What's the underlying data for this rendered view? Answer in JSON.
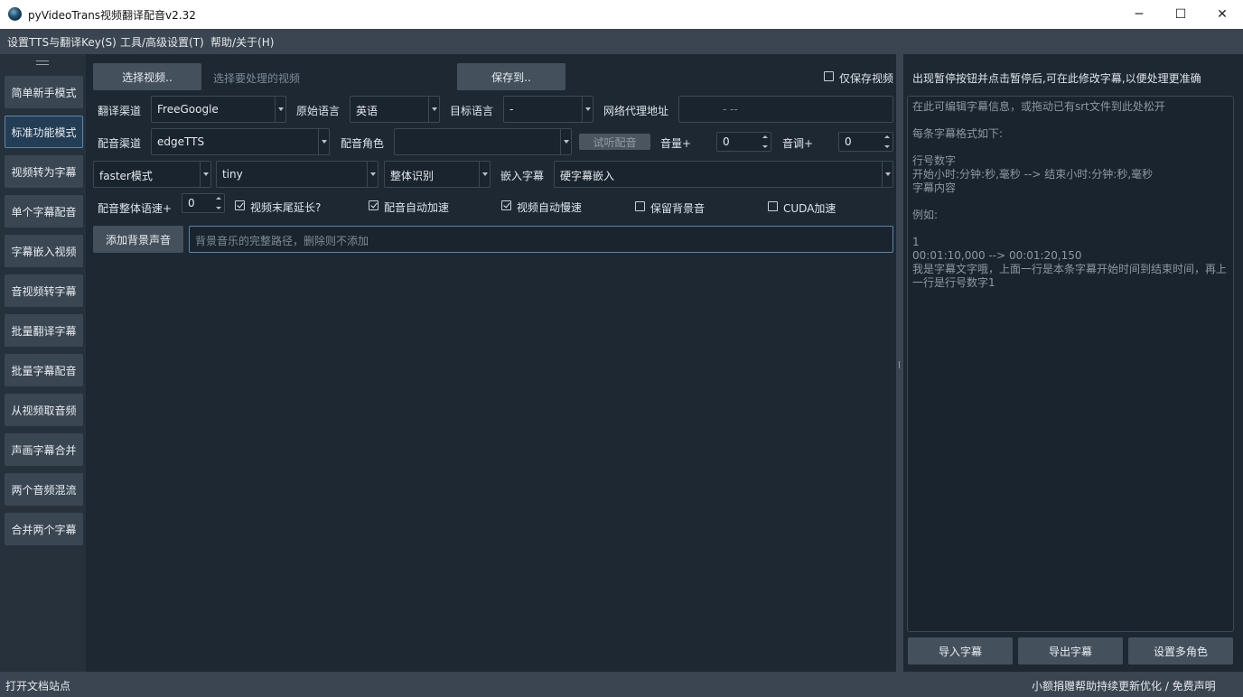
{
  "window": {
    "title": "pyVideoTrans视频翻译配音v2.32",
    "minimize_glyph": "─",
    "maximize_glyph": "☐",
    "close_glyph": "✕"
  },
  "menu": {
    "items": [
      "设置TTS与翻译Key(S)",
      "工具/高级设置(T)",
      "帮助/关于(H)"
    ]
  },
  "sidebar": {
    "items": [
      "简单新手模式",
      "标准功能模式",
      "视频转为字幕",
      "单个字幕配音",
      "字幕嵌入视频",
      "音视频转字幕",
      "批量翻译字幕",
      "批量字幕配音",
      "从视频取音频",
      "声画字幕合并",
      "两个音频混流",
      "合并两个字幕"
    ],
    "active_index": 1
  },
  "main": {
    "select_video_button": "选择视频..",
    "select_video_hint": "选择要处理的视频",
    "save_to_button": "保存到..",
    "only_save_video": "仅保存视频",
    "translate_channel_label": "翻译渠道",
    "translate_channel_value": "FreeGoogle",
    "source_lang_label": "原始语言",
    "source_lang_value": "英语",
    "target_lang_label": "目标语言",
    "target_lang_value": "-",
    "proxy_label": "网络代理地址",
    "proxy_placeholder": "-  --",
    "tts_channel_label": "配音渠道",
    "tts_channel_value": "edgeTTS",
    "voice_role_label": "配音角色",
    "voice_role_value": "",
    "listen_button": "试听配音",
    "volume_label": "音量+",
    "volume_value": "0",
    "pitch_label": "音调+",
    "pitch_value": "0",
    "model_mode_value": "faster模式",
    "model_size_value": "tiny",
    "recognition_value": "整体识别",
    "embed_sub_label": "嵌入字幕",
    "embed_sub_value": "硬字幕嵌入",
    "speed_label": "配音整体语速+",
    "speed_value": "0",
    "video_extend_label": "视频末尾延长?",
    "video_extend_checked": true,
    "auto_speedup_label": "配音自动加速",
    "auto_speedup_checked": true,
    "auto_slowdown_label": "视频自动慢速",
    "auto_slowdown_checked": true,
    "keep_bg_label": "保留背景音",
    "keep_bg_checked": false,
    "cuda_label": "CUDA加速",
    "cuda_checked": false,
    "add_bg_button": "添加背景声音",
    "bg_path_placeholder": "背景音乐的完整路径，删除则不添加"
  },
  "right": {
    "hint": "出现暂停按钮并点击暂停后,可在此修改字幕,以便处理更准确",
    "editor_lines": [
      "在此可编辑字幕信息，或拖动已有srt文件到此处松开",
      "",
      "每条字幕格式如下:",
      "",
      "行号数字",
      "开始小时:分钟:秒,毫秒 --> 结束小时:分钟:秒,毫秒",
      "字幕内容",
      "",
      "例如:",
      "",
      "1",
      "00:01:10,000 --> 00:01:20,150",
      "我是字幕文字哦，上面一行是本条字幕开始时间到结束时间，再上一行是行号数字1"
    ],
    "import_button": "导入字幕",
    "export_button": "导出字幕",
    "multi_role_button": "设置多角色"
  },
  "status": {
    "left": "打开文档站点",
    "right": "小额捐赠帮助持续更新优化 / 免费声明"
  },
  "colors": {
    "bg": "#1b2631",
    "panel": "#1d2833",
    "button": "#44505c",
    "bar": "#3a4551",
    "accent": "#5b86aa"
  }
}
